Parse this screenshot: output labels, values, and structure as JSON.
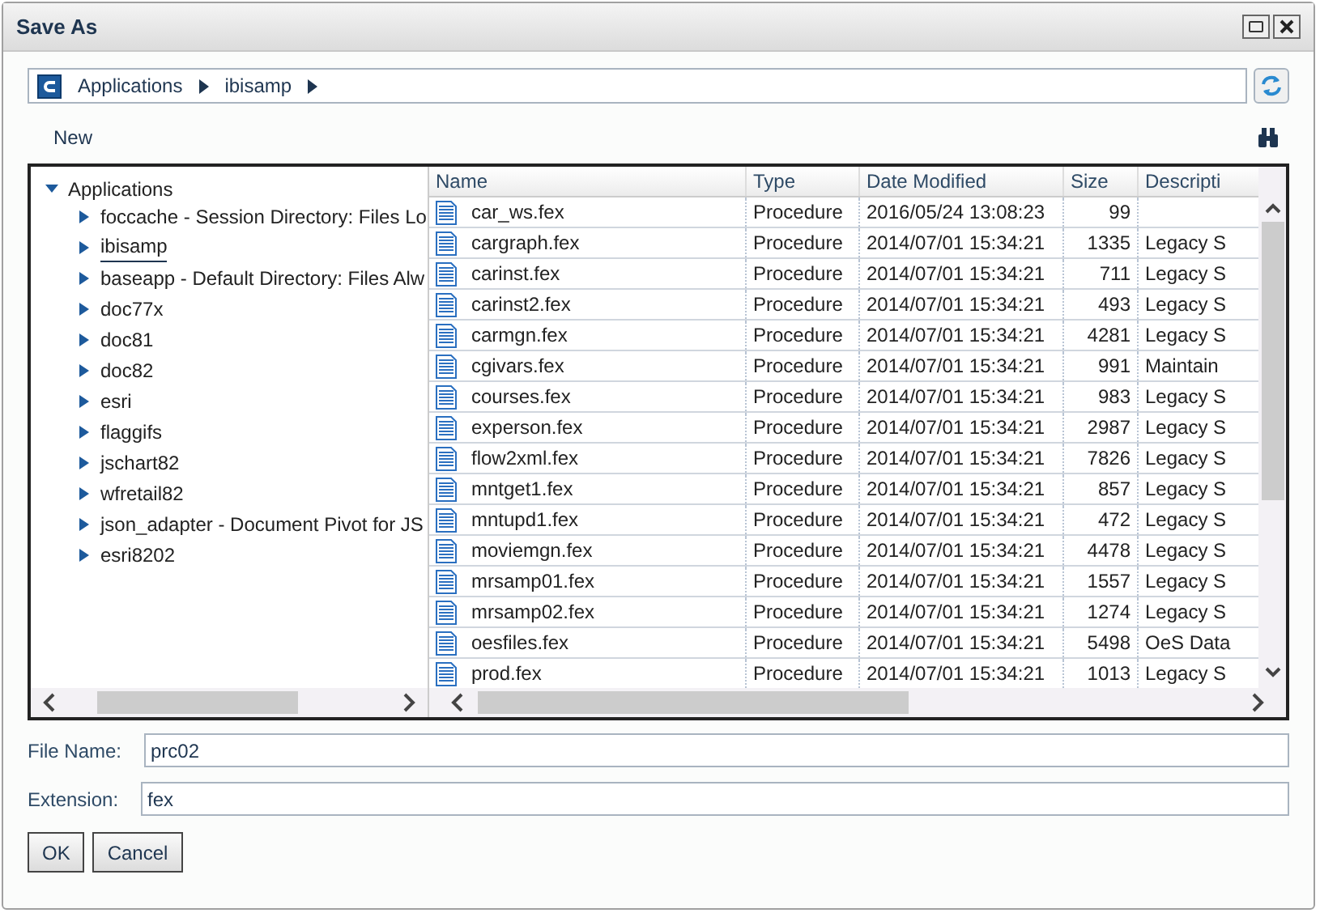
{
  "window": {
    "title": "Save As"
  },
  "breadcrumb": [
    "Applications",
    "ibisamp"
  ],
  "toolbar": {
    "new_label": "New"
  },
  "tree": {
    "label": "Applications",
    "expanded": true,
    "children": [
      {
        "label": "foccache - Session Directory: Files Lo",
        "expanded": false,
        "selected": false
      },
      {
        "label": "ibisamp",
        "expanded": false,
        "selected": true
      },
      {
        "label": "baseapp - Default Directory: Files Alw",
        "expanded": false,
        "selected": false
      },
      {
        "label": "doc77x",
        "expanded": false,
        "selected": false
      },
      {
        "label": "doc81",
        "expanded": false,
        "selected": false
      },
      {
        "label": "doc82",
        "expanded": false,
        "selected": false
      },
      {
        "label": "esri",
        "expanded": false,
        "selected": false
      },
      {
        "label": "flaggifs",
        "expanded": false,
        "selected": false
      },
      {
        "label": "jschart82",
        "expanded": false,
        "selected": false
      },
      {
        "label": "wfretail82",
        "expanded": false,
        "selected": false
      },
      {
        "label": "json_adapter - Document Pivot for JS",
        "expanded": false,
        "selected": false
      },
      {
        "label": "esri8202",
        "expanded": false,
        "selected": false
      }
    ]
  },
  "table": {
    "columns": [
      "Name",
      "Type",
      "Date Modified",
      "Size",
      "Descripti"
    ],
    "rows": [
      [
        "car_ws.fex",
        "Procedure",
        "2016/05/24 13:08:23",
        "99",
        ""
      ],
      [
        "cargraph.fex",
        "Procedure",
        "2014/07/01 15:34:21",
        "1335",
        "Legacy S"
      ],
      [
        "carinst.fex",
        "Procedure",
        "2014/07/01 15:34:21",
        "711",
        "Legacy S"
      ],
      [
        "carinst2.fex",
        "Procedure",
        "2014/07/01 15:34:21",
        "493",
        "Legacy S"
      ],
      [
        "carmgn.fex",
        "Procedure",
        "2014/07/01 15:34:21",
        "4281",
        "Legacy S"
      ],
      [
        "cgivars.fex",
        "Procedure",
        "2014/07/01 15:34:21",
        "991",
        "Maintain"
      ],
      [
        "courses.fex",
        "Procedure",
        "2014/07/01 15:34:21",
        "983",
        "Legacy S"
      ],
      [
        "experson.fex",
        "Procedure",
        "2014/07/01 15:34:21",
        "2987",
        "Legacy S"
      ],
      [
        "flow2xml.fex",
        "Procedure",
        "2014/07/01 15:34:21",
        "7826",
        "Legacy S"
      ],
      [
        "mntget1.fex",
        "Procedure",
        "2014/07/01 15:34:21",
        "857",
        "Legacy S"
      ],
      [
        "mntupd1.fex",
        "Procedure",
        "2014/07/01 15:34:21",
        "472",
        "Legacy S"
      ],
      [
        "moviemgn.fex",
        "Procedure",
        "2014/07/01 15:34:21",
        "4478",
        "Legacy S"
      ],
      [
        "mrsamp01.fex",
        "Procedure",
        "2014/07/01 15:34:21",
        "1557",
        "Legacy S"
      ],
      [
        "mrsamp02.fex",
        "Procedure",
        "2014/07/01 15:34:21",
        "1274",
        "Legacy S"
      ],
      [
        "oesfiles.fex",
        "Procedure",
        "2014/07/01 15:34:21",
        "5498",
        "OeS Data"
      ],
      [
        "prod.fex",
        "Procedure",
        "2014/07/01 15:34:21",
        "1013",
        "Legacy S"
      ]
    ]
  },
  "form": {
    "file_name_label": "File Name:",
    "file_name": "prc02",
    "extension_label": "Extension:",
    "extension": "fex"
  },
  "buttons": [
    "OK",
    "Cancel"
  ]
}
